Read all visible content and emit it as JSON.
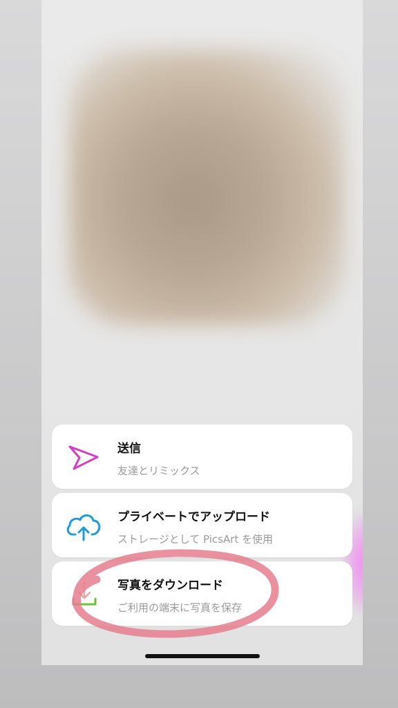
{
  "share_sheet": {
    "options": [
      {
        "title": "送信",
        "subtitle": "友達とリミックス",
        "icon": "send-icon"
      },
      {
        "title": "プライベートでアップロード",
        "subtitle": "ストレージとして PicsArt を使用",
        "icon": "cloud-upload-icon"
      },
      {
        "title": "写真をダウンロード",
        "subtitle": "ご利用の端末に写真を保存",
        "icon": "download-icon"
      }
    ]
  },
  "colors": {
    "send_icon": "#d23ec8",
    "upload_icon": "#1c9be0",
    "download_arrow": "#e8a6a6",
    "download_tray": "#6fbf3a",
    "annotation_circle": "#e57e8e",
    "pink_glow": "#f08ef0"
  }
}
